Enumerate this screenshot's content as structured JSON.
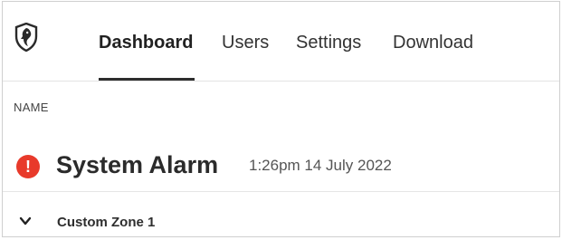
{
  "header": {
    "logo_icon": "shield-logo-icon",
    "tabs": [
      {
        "label": "Dashboard",
        "active": true
      },
      {
        "label": "Users",
        "active": false
      },
      {
        "label": "Settings",
        "active": false
      },
      {
        "label": "Download",
        "active": false
      }
    ]
  },
  "table": {
    "column_header": "NAME"
  },
  "alarm": {
    "icon": "exclamation-circle-icon",
    "icon_glyph": "!",
    "title": "System Alarm",
    "timestamp": "1:26pm 14 July 2022",
    "status_color": "#e83a2b"
  },
  "zone": {
    "icon": "chevron-down-icon",
    "label": "Custom Zone 1"
  }
}
